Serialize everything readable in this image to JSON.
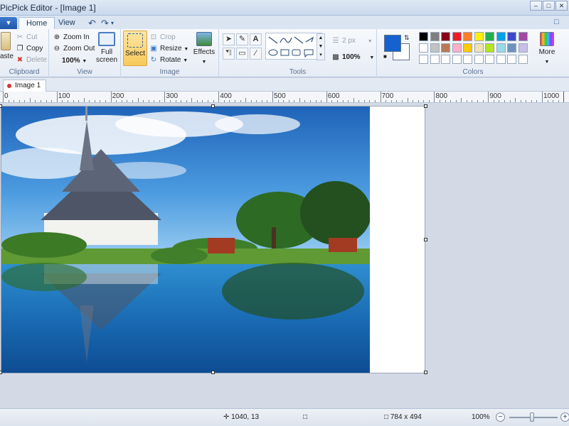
{
  "window": {
    "title": "PicPick Editor - [Image 1]"
  },
  "tabs": [
    {
      "label": "Home"
    },
    {
      "label": "View"
    }
  ],
  "clipboard": {
    "paste": "aste",
    "cut": "Cut",
    "copy": "Copy",
    "delete": "Delete",
    "label": "Clipboard"
  },
  "view": {
    "zoom_in": "Zoom In",
    "zoom_out": "Zoom Out",
    "zoom_value": "100%",
    "full_screen_1": "Full",
    "full_screen_2": "screen",
    "label": "View"
  },
  "image": {
    "select": "Select",
    "crop": "Crop",
    "resize": "Resize",
    "rotate": "Rotate",
    "effects": "Effects",
    "label": "Image"
  },
  "tools": {
    "label": "Tools",
    "line_width": "2 px",
    "opacity": "100%"
  },
  "colors": {
    "label": "Colors",
    "more": "More",
    "color1": "#1462d0",
    "palette_row1": [
      "#000000",
      "#7f7f7f",
      "#880015",
      "#ed1c24",
      "#ff7f27",
      "#fff200",
      "#22b14c",
      "#00a2e8",
      "#3f48cc",
      "#a349a4"
    ],
    "palette_row2": [
      "#ffffff",
      "#c3c3c3",
      "#b97a57",
      "#ffaec9",
      "#ffc90e",
      "#efe4b0",
      "#b5e61d",
      "#99d9ea",
      "#7092be",
      "#c8bfe7"
    ],
    "palette_row3": [
      "#ffffff",
      "#ffffff",
      "#ffffff",
      "#ffffff",
      "#ffffff",
      "#ffffff",
      "#ffffff",
      "#ffffff",
      "#ffffff",
      "#ffffff"
    ]
  },
  "document": {
    "tab_label": "Image 1"
  },
  "ruler": {
    "labels": [
      "0",
      "100",
      "200",
      "300",
      "400",
      "500",
      "600",
      "700",
      "800",
      "900",
      "1000"
    ]
  },
  "status": {
    "cursor": "1040, 13",
    "size": "784 x 494",
    "zoom": "100%"
  }
}
